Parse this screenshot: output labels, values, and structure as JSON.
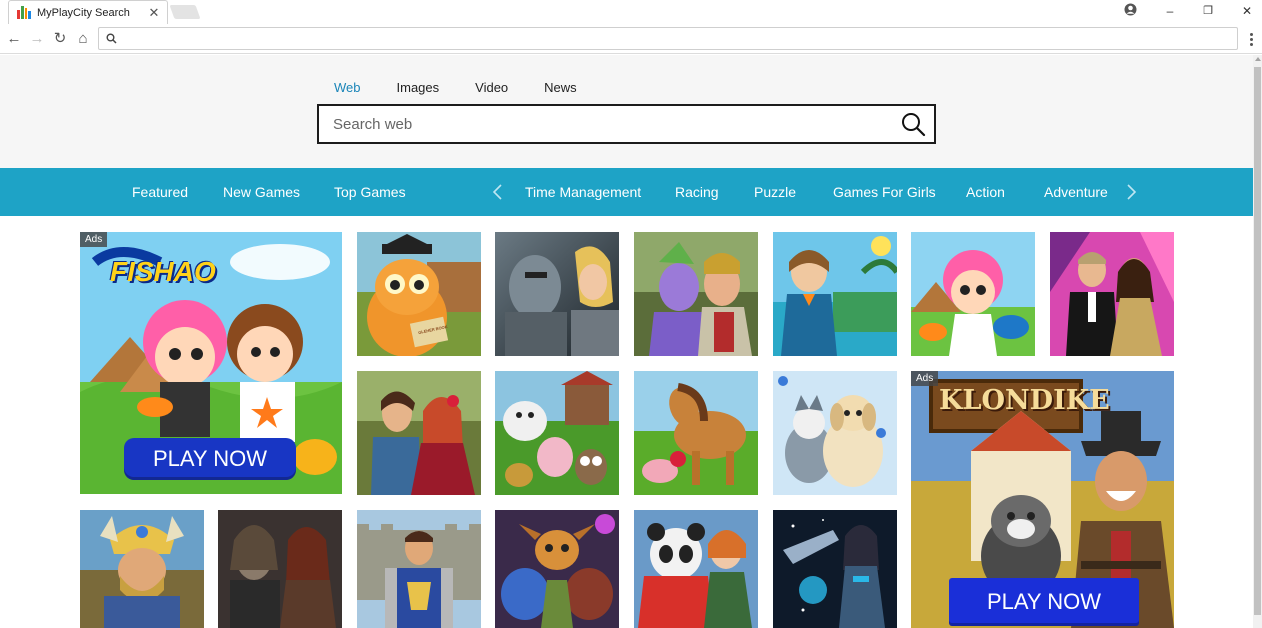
{
  "browser": {
    "tab_title": "MyPlayCity Search",
    "tab_close": "✕",
    "window_controls": {
      "minimize": "–",
      "restore": "❐",
      "close": "✕"
    },
    "nav": {
      "back": "←",
      "forward": "→",
      "reload": "↻",
      "home": "⌂"
    },
    "address_value": ""
  },
  "search": {
    "tabs": [
      {
        "label": "Web",
        "active": true
      },
      {
        "label": "Images",
        "active": false
      },
      {
        "label": "Video",
        "active": false
      },
      {
        "label": "News",
        "active": false
      }
    ],
    "placeholder": "Search web"
  },
  "categories": {
    "left": [
      "Featured",
      "New Games",
      "Top Games"
    ],
    "right": [
      "Time Management",
      "Racing",
      "Puzzle",
      "Games For Girls",
      "Action",
      "Adventure"
    ]
  },
  "colors": {
    "category_bar": "#1ea3c6",
    "active_tab": "#1a85b8",
    "play_button": "#1836c4"
  },
  "ads": {
    "fishao": {
      "badge": "Ads",
      "logo": "FISHAO",
      "button": "PLAY NOW"
    },
    "klondike": {
      "badge": "Ads",
      "logo": "KLONDIKE",
      "button": "PLAY NOW"
    }
  },
  "tiles": [
    {
      "name": "cat-scholar-game",
      "icon": "orange-cat",
      "book_label": "GLEHER BOOK"
    },
    {
      "name": "knight-warriors-game",
      "icon": "armored-knight"
    },
    {
      "name": "elf-heroes-game",
      "icon": "elf-warrior"
    },
    {
      "name": "resort-manager-game",
      "icon": "resort-woman"
    },
    {
      "name": "fishao-girl-game",
      "icon": "cartoon-girl"
    },
    {
      "name": "fashion-couple-game",
      "icon": "fashion-couple"
    },
    {
      "name": "romance-tale-game",
      "icon": "romantic-couple"
    },
    {
      "name": "farm-animals-game",
      "icon": "farm-animals"
    },
    {
      "name": "pony-farm-game",
      "icon": "pony"
    },
    {
      "name": "puppy-pets-game",
      "icon": "puppies"
    },
    {
      "name": "viking-king-game",
      "icon": "viking"
    },
    {
      "name": "dark-warriors-game",
      "icon": "dark-warriors"
    },
    {
      "name": "castle-knight-game",
      "icon": "castle-knight"
    },
    {
      "name": "goblin-tribe-game",
      "icon": "goblins"
    },
    {
      "name": "panda-adventure-game",
      "icon": "panda"
    },
    {
      "name": "space-pilot-game",
      "icon": "space-girl"
    }
  ]
}
